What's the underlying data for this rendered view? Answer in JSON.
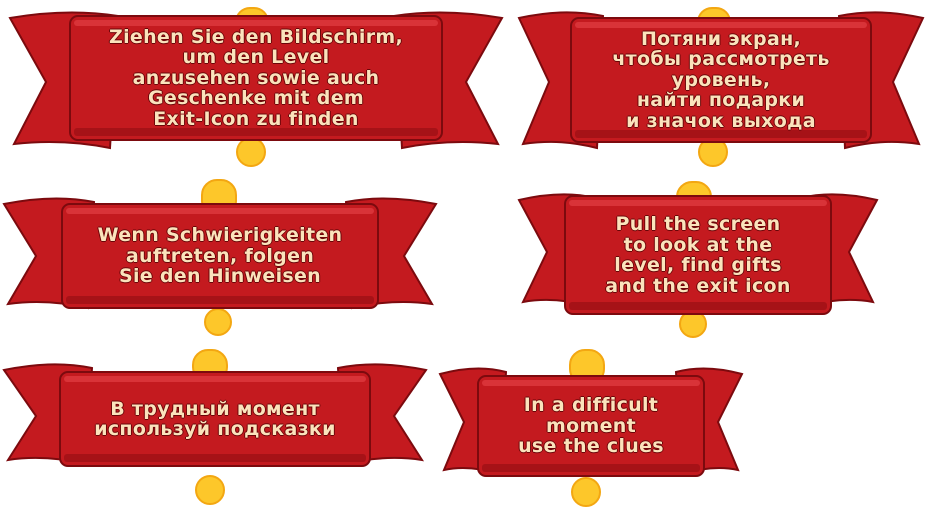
{
  "banners": [
    {
      "id": "de-drag",
      "lang": "de",
      "text": "Ziehen Sie den Bildschirm,\num den Level\nanzusehen sowie auch\nGeschenke mit dem\nExit-Icon zu finden"
    },
    {
      "id": "ru-drag",
      "lang": "ru",
      "text": "Потяни экран,\nчтобы рассмотреть\nуровень,\nнайти подарки\nи значок выхода"
    },
    {
      "id": "de-hints",
      "lang": "de",
      "text": "Wenn Schwierigkeiten\nauftreten, folgen\nSie den Hinweisen"
    },
    {
      "id": "en-drag",
      "lang": "en",
      "text": "Pull the screen\nto look at the\nlevel, find gifts\nand the exit icon"
    },
    {
      "id": "ru-hints",
      "lang": "ru",
      "text": "В трудный момент\nиспользуй подсказки"
    },
    {
      "id": "en-hints",
      "lang": "en",
      "text": "In a difficult\nmoment\nuse the clues"
    }
  ],
  "colors": {
    "ribbon": "#c41a1f",
    "ribbon_dark": "#7c0a0e",
    "ribbon_light": "#e8454a",
    "exclamation": "#fdc72a",
    "text": "#fbe3bc"
  },
  "icons": [
    "exclamation-icon"
  ]
}
